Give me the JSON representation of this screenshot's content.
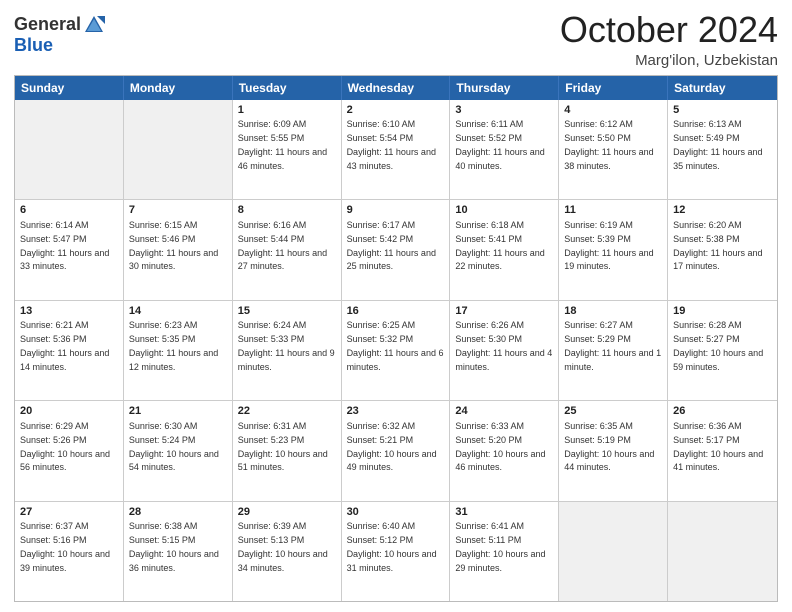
{
  "header": {
    "logo_general": "General",
    "logo_blue": "Blue",
    "month_title": "October 2024",
    "location": "Marg'ilon, Uzbekistan"
  },
  "days_of_week": [
    "Sunday",
    "Monday",
    "Tuesday",
    "Wednesday",
    "Thursday",
    "Friday",
    "Saturday"
  ],
  "weeks": [
    [
      {
        "day": "",
        "sunrise": "",
        "sunset": "",
        "daylight": "",
        "empty": true
      },
      {
        "day": "",
        "sunrise": "",
        "sunset": "",
        "daylight": "",
        "empty": true
      },
      {
        "day": "1",
        "sunrise": "Sunrise: 6:09 AM",
        "sunset": "Sunset: 5:55 PM",
        "daylight": "Daylight: 11 hours and 46 minutes.",
        "empty": false
      },
      {
        "day": "2",
        "sunrise": "Sunrise: 6:10 AM",
        "sunset": "Sunset: 5:54 PM",
        "daylight": "Daylight: 11 hours and 43 minutes.",
        "empty": false
      },
      {
        "day": "3",
        "sunrise": "Sunrise: 6:11 AM",
        "sunset": "Sunset: 5:52 PM",
        "daylight": "Daylight: 11 hours and 40 minutes.",
        "empty": false
      },
      {
        "day": "4",
        "sunrise": "Sunrise: 6:12 AM",
        "sunset": "Sunset: 5:50 PM",
        "daylight": "Daylight: 11 hours and 38 minutes.",
        "empty": false
      },
      {
        "day": "5",
        "sunrise": "Sunrise: 6:13 AM",
        "sunset": "Sunset: 5:49 PM",
        "daylight": "Daylight: 11 hours and 35 minutes.",
        "empty": false
      }
    ],
    [
      {
        "day": "6",
        "sunrise": "Sunrise: 6:14 AM",
        "sunset": "Sunset: 5:47 PM",
        "daylight": "Daylight: 11 hours and 33 minutes.",
        "empty": false
      },
      {
        "day": "7",
        "sunrise": "Sunrise: 6:15 AM",
        "sunset": "Sunset: 5:46 PM",
        "daylight": "Daylight: 11 hours and 30 minutes.",
        "empty": false
      },
      {
        "day": "8",
        "sunrise": "Sunrise: 6:16 AM",
        "sunset": "Sunset: 5:44 PM",
        "daylight": "Daylight: 11 hours and 27 minutes.",
        "empty": false
      },
      {
        "day": "9",
        "sunrise": "Sunrise: 6:17 AM",
        "sunset": "Sunset: 5:42 PM",
        "daylight": "Daylight: 11 hours and 25 minutes.",
        "empty": false
      },
      {
        "day": "10",
        "sunrise": "Sunrise: 6:18 AM",
        "sunset": "Sunset: 5:41 PM",
        "daylight": "Daylight: 11 hours and 22 minutes.",
        "empty": false
      },
      {
        "day": "11",
        "sunrise": "Sunrise: 6:19 AM",
        "sunset": "Sunset: 5:39 PM",
        "daylight": "Daylight: 11 hours and 19 minutes.",
        "empty": false
      },
      {
        "day": "12",
        "sunrise": "Sunrise: 6:20 AM",
        "sunset": "Sunset: 5:38 PM",
        "daylight": "Daylight: 11 hours and 17 minutes.",
        "empty": false
      }
    ],
    [
      {
        "day": "13",
        "sunrise": "Sunrise: 6:21 AM",
        "sunset": "Sunset: 5:36 PM",
        "daylight": "Daylight: 11 hours and 14 minutes.",
        "empty": false
      },
      {
        "day": "14",
        "sunrise": "Sunrise: 6:23 AM",
        "sunset": "Sunset: 5:35 PM",
        "daylight": "Daylight: 11 hours and 12 minutes.",
        "empty": false
      },
      {
        "day": "15",
        "sunrise": "Sunrise: 6:24 AM",
        "sunset": "Sunset: 5:33 PM",
        "daylight": "Daylight: 11 hours and 9 minutes.",
        "empty": false
      },
      {
        "day": "16",
        "sunrise": "Sunrise: 6:25 AM",
        "sunset": "Sunset: 5:32 PM",
        "daylight": "Daylight: 11 hours and 6 minutes.",
        "empty": false
      },
      {
        "day": "17",
        "sunrise": "Sunrise: 6:26 AM",
        "sunset": "Sunset: 5:30 PM",
        "daylight": "Daylight: 11 hours and 4 minutes.",
        "empty": false
      },
      {
        "day": "18",
        "sunrise": "Sunrise: 6:27 AM",
        "sunset": "Sunset: 5:29 PM",
        "daylight": "Daylight: 11 hours and 1 minute.",
        "empty": false
      },
      {
        "day": "19",
        "sunrise": "Sunrise: 6:28 AM",
        "sunset": "Sunset: 5:27 PM",
        "daylight": "Daylight: 10 hours and 59 minutes.",
        "empty": false
      }
    ],
    [
      {
        "day": "20",
        "sunrise": "Sunrise: 6:29 AM",
        "sunset": "Sunset: 5:26 PM",
        "daylight": "Daylight: 10 hours and 56 minutes.",
        "empty": false
      },
      {
        "day": "21",
        "sunrise": "Sunrise: 6:30 AM",
        "sunset": "Sunset: 5:24 PM",
        "daylight": "Daylight: 10 hours and 54 minutes.",
        "empty": false
      },
      {
        "day": "22",
        "sunrise": "Sunrise: 6:31 AM",
        "sunset": "Sunset: 5:23 PM",
        "daylight": "Daylight: 10 hours and 51 minutes.",
        "empty": false
      },
      {
        "day": "23",
        "sunrise": "Sunrise: 6:32 AM",
        "sunset": "Sunset: 5:21 PM",
        "daylight": "Daylight: 10 hours and 49 minutes.",
        "empty": false
      },
      {
        "day": "24",
        "sunrise": "Sunrise: 6:33 AM",
        "sunset": "Sunset: 5:20 PM",
        "daylight": "Daylight: 10 hours and 46 minutes.",
        "empty": false
      },
      {
        "day": "25",
        "sunrise": "Sunrise: 6:35 AM",
        "sunset": "Sunset: 5:19 PM",
        "daylight": "Daylight: 10 hours and 44 minutes.",
        "empty": false
      },
      {
        "day": "26",
        "sunrise": "Sunrise: 6:36 AM",
        "sunset": "Sunset: 5:17 PM",
        "daylight": "Daylight: 10 hours and 41 minutes.",
        "empty": false
      }
    ],
    [
      {
        "day": "27",
        "sunrise": "Sunrise: 6:37 AM",
        "sunset": "Sunset: 5:16 PM",
        "daylight": "Daylight: 10 hours and 39 minutes.",
        "empty": false
      },
      {
        "day": "28",
        "sunrise": "Sunrise: 6:38 AM",
        "sunset": "Sunset: 5:15 PM",
        "daylight": "Daylight: 10 hours and 36 minutes.",
        "empty": false
      },
      {
        "day": "29",
        "sunrise": "Sunrise: 6:39 AM",
        "sunset": "Sunset: 5:13 PM",
        "daylight": "Daylight: 10 hours and 34 minutes.",
        "empty": false
      },
      {
        "day": "30",
        "sunrise": "Sunrise: 6:40 AM",
        "sunset": "Sunset: 5:12 PM",
        "daylight": "Daylight: 10 hours and 31 minutes.",
        "empty": false
      },
      {
        "day": "31",
        "sunrise": "Sunrise: 6:41 AM",
        "sunset": "Sunset: 5:11 PM",
        "daylight": "Daylight: 10 hours and 29 minutes.",
        "empty": false
      },
      {
        "day": "",
        "sunrise": "",
        "sunset": "",
        "daylight": "",
        "empty": true
      },
      {
        "day": "",
        "sunrise": "",
        "sunset": "",
        "daylight": "",
        "empty": true
      }
    ]
  ]
}
